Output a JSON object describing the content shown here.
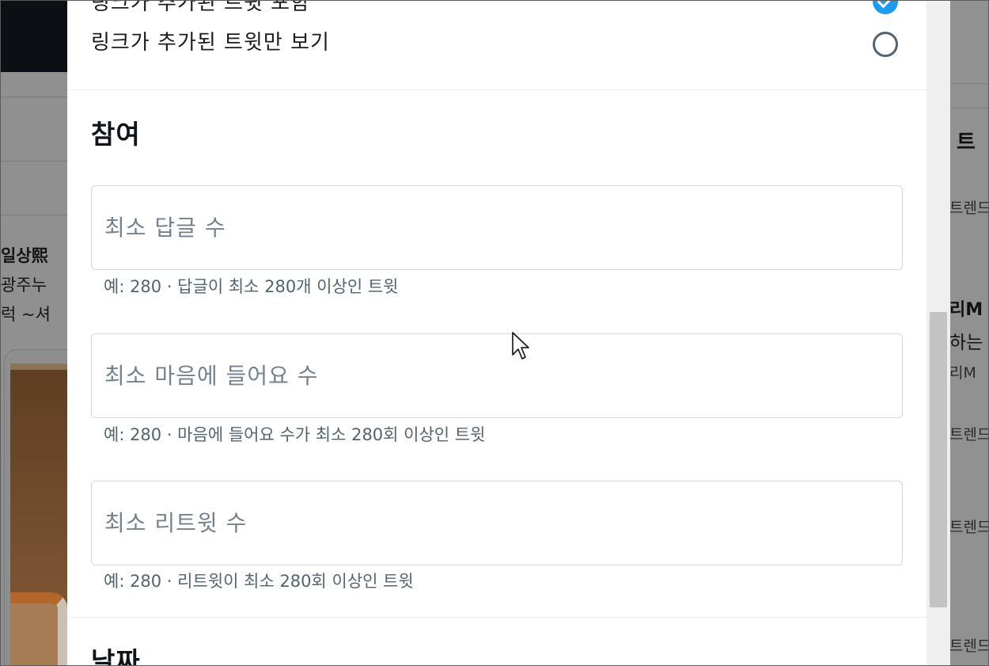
{
  "background_page": {
    "left_column_lines": [
      "일상熙",
      "광주누",
      "럭 ~셔"
    ],
    "right_column": {
      "section_head": "트",
      "trend_label": "트렌드",
      "account_name": "리M",
      "account_desc": "하는",
      "account_handle": "리M"
    }
  },
  "link_filter": {
    "option_include_label": "링크가 추가된 트윗 포함",
    "option_include_selected": true,
    "option_only_label": "링크가 추가된 트윗만 보기",
    "option_only_selected": false
  },
  "engagement": {
    "title": "참여",
    "fields": [
      {
        "placeholder": "최소 답글 수",
        "value": "",
        "hint": "예: 280 · 답글이 최소 280개 이상인 트윗"
      },
      {
        "placeholder": "최소 마음에 들어요 수",
        "value": "",
        "hint": "예: 280 · 마음에 들어요 수가 최소 280회 이상인 트윗"
      },
      {
        "placeholder": "최소 리트윗 수",
        "value": "",
        "hint": "예: 280 · 리트윗이 최소 280회 이상인 트윗"
      }
    ]
  },
  "date_section": {
    "title": "날짜"
  },
  "colors": {
    "accent": "#1d9bf0",
    "placeholder": "#75828d",
    "hint": "#536471",
    "field_border": "#cfd9de"
  }
}
